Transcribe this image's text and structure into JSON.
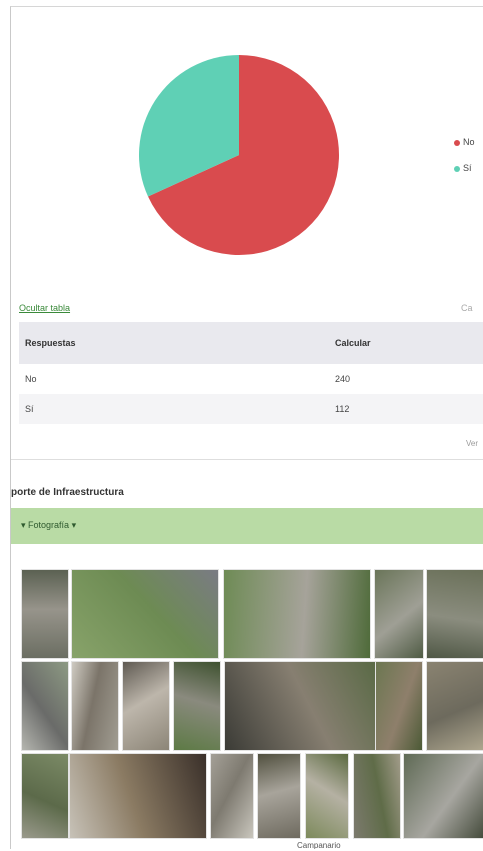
{
  "chart_data": {
    "type": "pie",
    "series": [
      {
        "name": "No",
        "value": 240,
        "color": "#d94b4e"
      },
      {
        "name": "Sí",
        "value": 112,
        "color": "#5fd0b5"
      }
    ]
  },
  "legend": {
    "items": [
      {
        "label": "No"
      },
      {
        "label": "Sí"
      }
    ]
  },
  "table_link": "Ocultar tabla",
  "truncated_right_label": "Ca",
  "table": {
    "headers": [
      "Respuestas",
      "Calcular"
    ],
    "rows": [
      {
        "answer": "No",
        "count": "240"
      },
      {
        "answer": "Sí",
        "count": "112"
      }
    ]
  },
  "see_more": "Ver",
  "section_title": "porte de Infraestructura",
  "photo_section_label": "Fotografía",
  "photo_caption": "Campanario",
  "photos": [
    {
      "name": "photo-01",
      "colors": [
        "#6b6e62",
        "#97948b",
        "#5b6152"
      ]
    },
    {
      "name": "photo-02",
      "colors": [
        "#88a36a",
        "#6d8b53",
        "#7a7b84"
      ]
    },
    {
      "name": "photo-03",
      "colors": [
        "#6e8b55",
        "#a6a39a",
        "#4f6b3a"
      ]
    },
    {
      "name": "photo-04",
      "colors": [
        "#6a7559",
        "#9f9f95",
        "#4f5b44"
      ]
    },
    {
      "name": "photo-05",
      "colors": [
        "#6a7059",
        "#8b8d7f",
        "#505846"
      ]
    },
    {
      "name": "photo-06",
      "colors": [
        "#8d9a83",
        "#6a6b69",
        "#b5b6b0"
      ]
    },
    {
      "name": "photo-07",
      "colors": [
        "#a19d92",
        "#7b7469",
        "#cfcbc2"
      ]
    },
    {
      "name": "photo-08",
      "colors": [
        "#8c8577",
        "#bdb6ab",
        "#5f5a52"
      ]
    },
    {
      "name": "photo-09",
      "colors": [
        "#5d7a45",
        "#8a8a7e",
        "#3f5230"
      ]
    },
    {
      "name": "photo-10",
      "colors": [
        "#3b3b36",
        "#877f71",
        "#5a6a46"
      ]
    },
    {
      "name": "photo-11",
      "colors": [
        "#6c7751",
        "#8e7f6b",
        "#4c5a36"
      ]
    },
    {
      "name": "photo-12",
      "colors": [
        "#8a8371",
        "#6d6a5d",
        "#b0a890"
      ]
    },
    {
      "name": "photo-13",
      "colors": [
        "#7b8a66",
        "#5c6a4a",
        "#9a9a8c"
      ]
    },
    {
      "name": "photo-14",
      "colors": [
        "#3a302a",
        "#8b7b63",
        "#c7c2b8"
      ]
    },
    {
      "name": "photo-15",
      "colors": [
        "#c9c6bd",
        "#7e7a70",
        "#a4a097"
      ]
    },
    {
      "name": "photo-16",
      "colors": [
        "#6e6a5f",
        "#a8a49b",
        "#51503f"
      ]
    },
    {
      "name": "photo-17",
      "colors": [
        "#7d8a5c",
        "#b5b1a3",
        "#5b6a40"
      ]
    },
    {
      "name": "photo-18",
      "colors": [
        "#7c7a6e",
        "#5f6c48",
        "#a19b89"
      ]
    },
    {
      "name": "photo-19",
      "colors": [
        "#5f6a55",
        "#a7a6a0",
        "#3f4636"
      ]
    }
  ]
}
